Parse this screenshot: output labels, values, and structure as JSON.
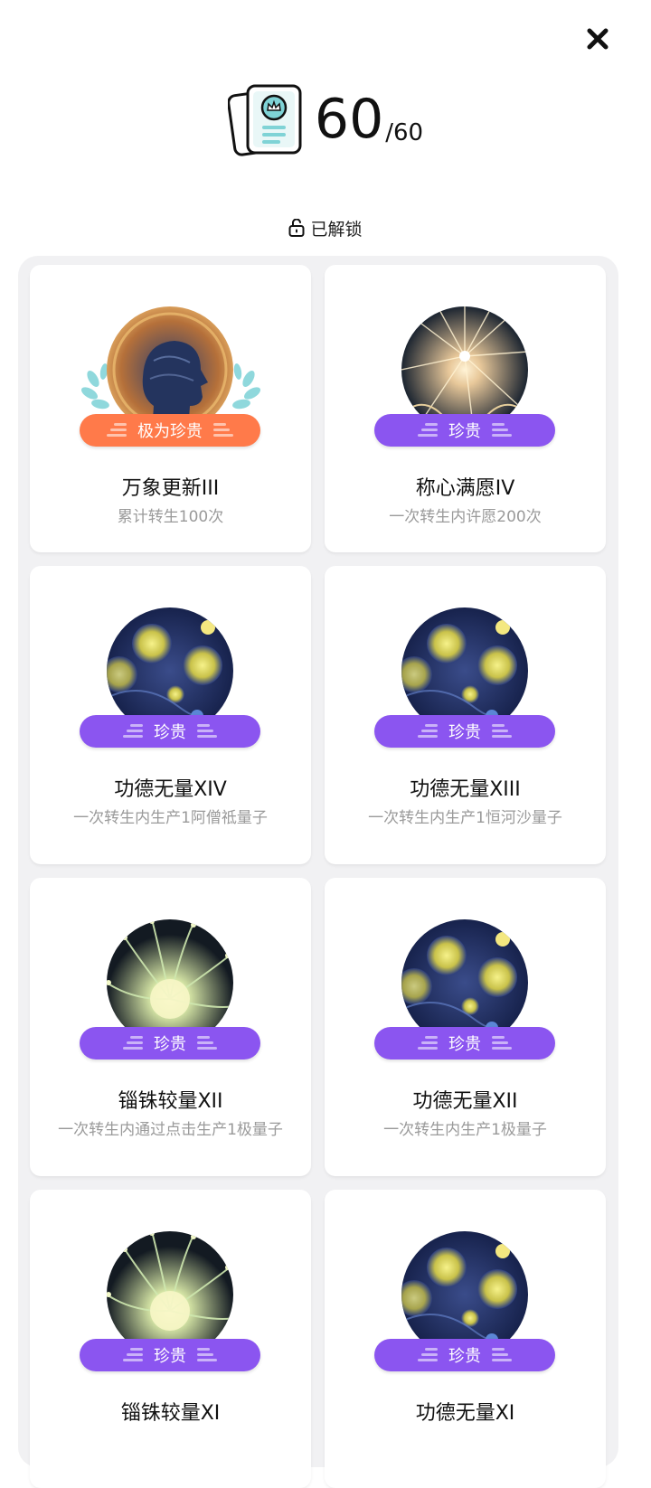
{
  "header": {
    "unlocked_count": "60",
    "total_count": "/60",
    "unlock_label": "已解锁"
  },
  "colors": {
    "legendary_pill": "#ff7a4a",
    "rare_pill": "#8b55f0",
    "laurel": "#8fd8dc",
    "card_icon_accent": "#7fd3d6"
  },
  "icons": {
    "close": "close-icon",
    "collection": "card-collection-icon",
    "unlock": "unlock-icon"
  },
  "achievements": [
    {
      "title": "万象更新III",
      "desc": "累计转生100次",
      "rarity": "极为珍贵",
      "art": "glowing-head"
    },
    {
      "title": "称心满愿IV",
      "desc": "一次转生内许愿200次",
      "rarity": "珍贵",
      "art": "starburst"
    },
    {
      "title": "功德无量XIV",
      "desc": "一次转生内生产1阿僧祗量子",
      "rarity": "珍贵",
      "art": "starry-night"
    },
    {
      "title": "功德无量XIII",
      "desc": "一次转生内生产1恒河沙量子",
      "rarity": "珍贵",
      "art": "starry-night"
    },
    {
      "title": "锱铢较量XII",
      "desc": "一次转生内通过点击生产1极量子",
      "rarity": "珍贵",
      "art": "neuron-burst"
    },
    {
      "title": "功德无量XII",
      "desc": "一次转生内生产1极量子",
      "rarity": "珍贵",
      "art": "starry-night"
    },
    {
      "title": "锱铢较量XI",
      "desc": "",
      "rarity": "珍贵",
      "art": "neuron-burst"
    },
    {
      "title": "功德无量XI",
      "desc": "",
      "rarity": "珍贵",
      "art": "starry-night"
    }
  ]
}
